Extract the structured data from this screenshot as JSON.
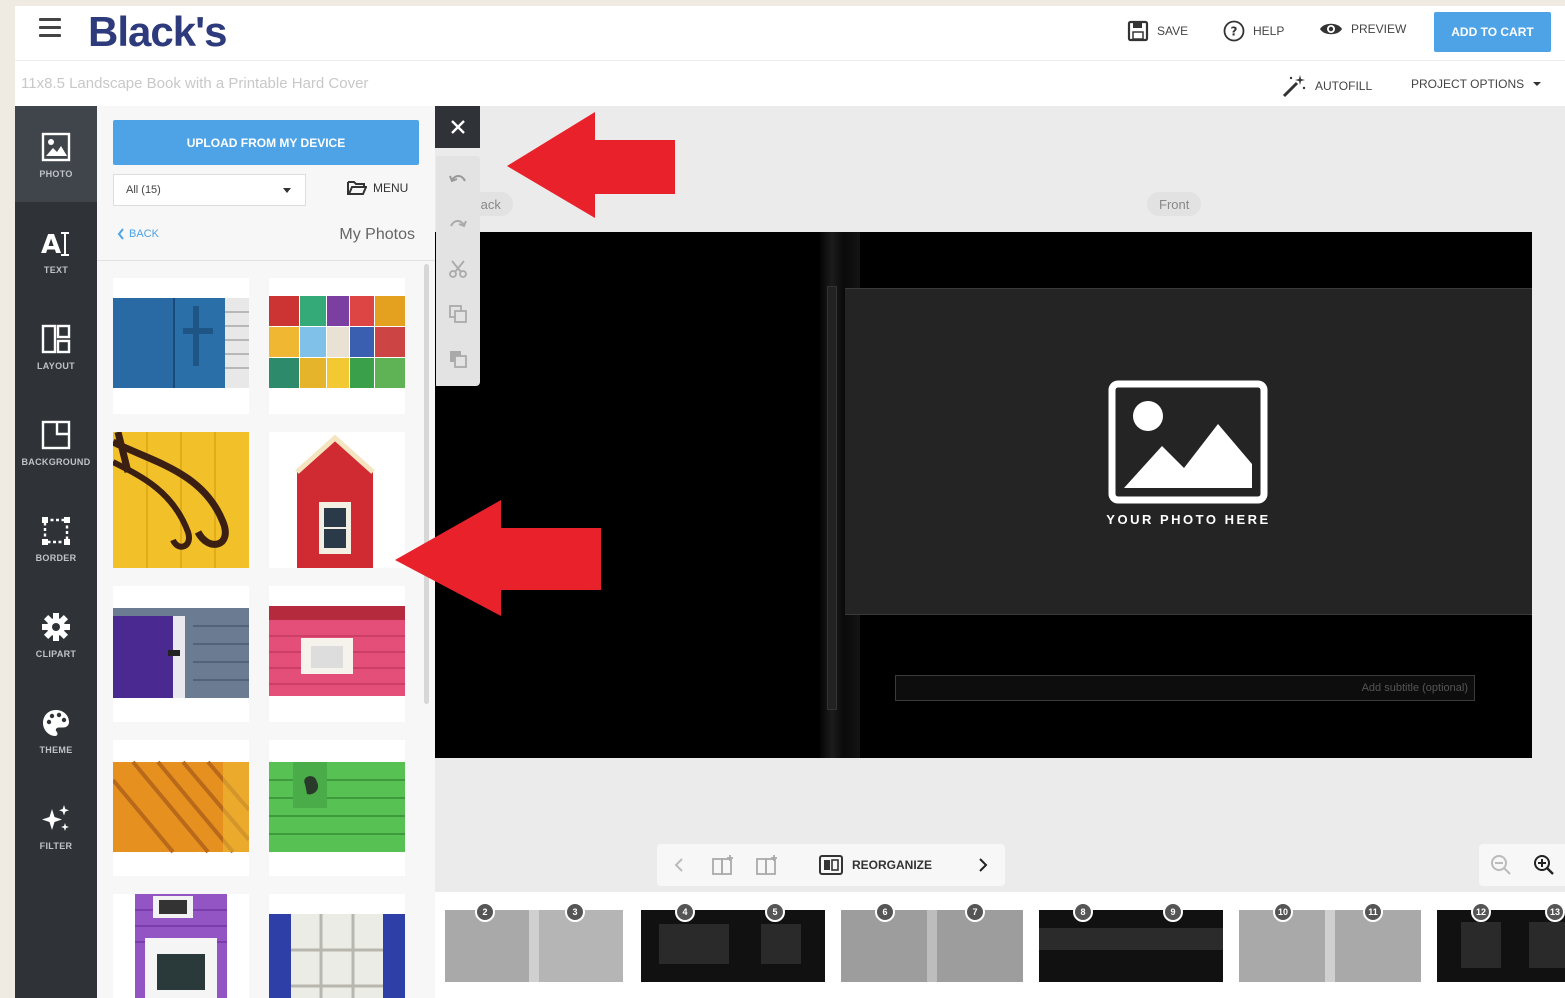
{
  "header": {
    "logo": "Black's",
    "save_label": "SAVE",
    "help_label": "HELP",
    "preview_label": "PREVIEW",
    "cart_label": "ADD TO CART"
  },
  "subbar": {
    "project_title": "11x8.5 Landscape Book with a Printable Hard Cover",
    "autofill_label": "AUTOFILL",
    "options_label": "PROJECT OPTIONS"
  },
  "rail": {
    "items": [
      {
        "label": "PHOTO",
        "icon": "photo-icon",
        "active": true
      },
      {
        "label": "TEXT",
        "icon": "text-icon"
      },
      {
        "label": "LAYOUT",
        "icon": "layout-icon"
      },
      {
        "label": "BACKGROUND",
        "icon": "background-icon"
      },
      {
        "label": "BORDER",
        "icon": "border-icon"
      },
      {
        "label": "CLIPART",
        "icon": "clipart-gear-icon"
      },
      {
        "label": "THEME",
        "icon": "palette-icon"
      },
      {
        "label": "FILTER",
        "icon": "sparkle-icon"
      }
    ]
  },
  "panel": {
    "upload_label": "UPLOAD FROM MY DEVICE",
    "album_value": "All (15)",
    "menu_label": "MENU",
    "back_label": "BACK",
    "title": "My Photos",
    "photos": [
      "blue-door-photo",
      "mosaic-photo",
      "wrought-iron-hinge-photo",
      "red-house-photo",
      "purple-door-photo",
      "pink-house-photo",
      "orange-siding-photo",
      "green-siding-photo",
      "purple-house-photo",
      "blue-window-photo"
    ]
  },
  "editor": {
    "back_page_label": "Back",
    "front_page_label": "Front",
    "placeholder_text": "YOUR PHOTO HERE",
    "subtitle_placeholder": "Add subtitle (optional)"
  },
  "bottom_nav": {
    "reorganize_label": "REORGANIZE"
  },
  "page_numbers": [
    "2",
    "3",
    "4",
    "5",
    "6",
    "7",
    "8",
    "9",
    "10",
    "11",
    "12",
    "13"
  ],
  "colors": {
    "brand": "#2d3a7b",
    "accent": "#4da3e6",
    "rail": "#2f3338",
    "arrow": "#e8212b"
  }
}
